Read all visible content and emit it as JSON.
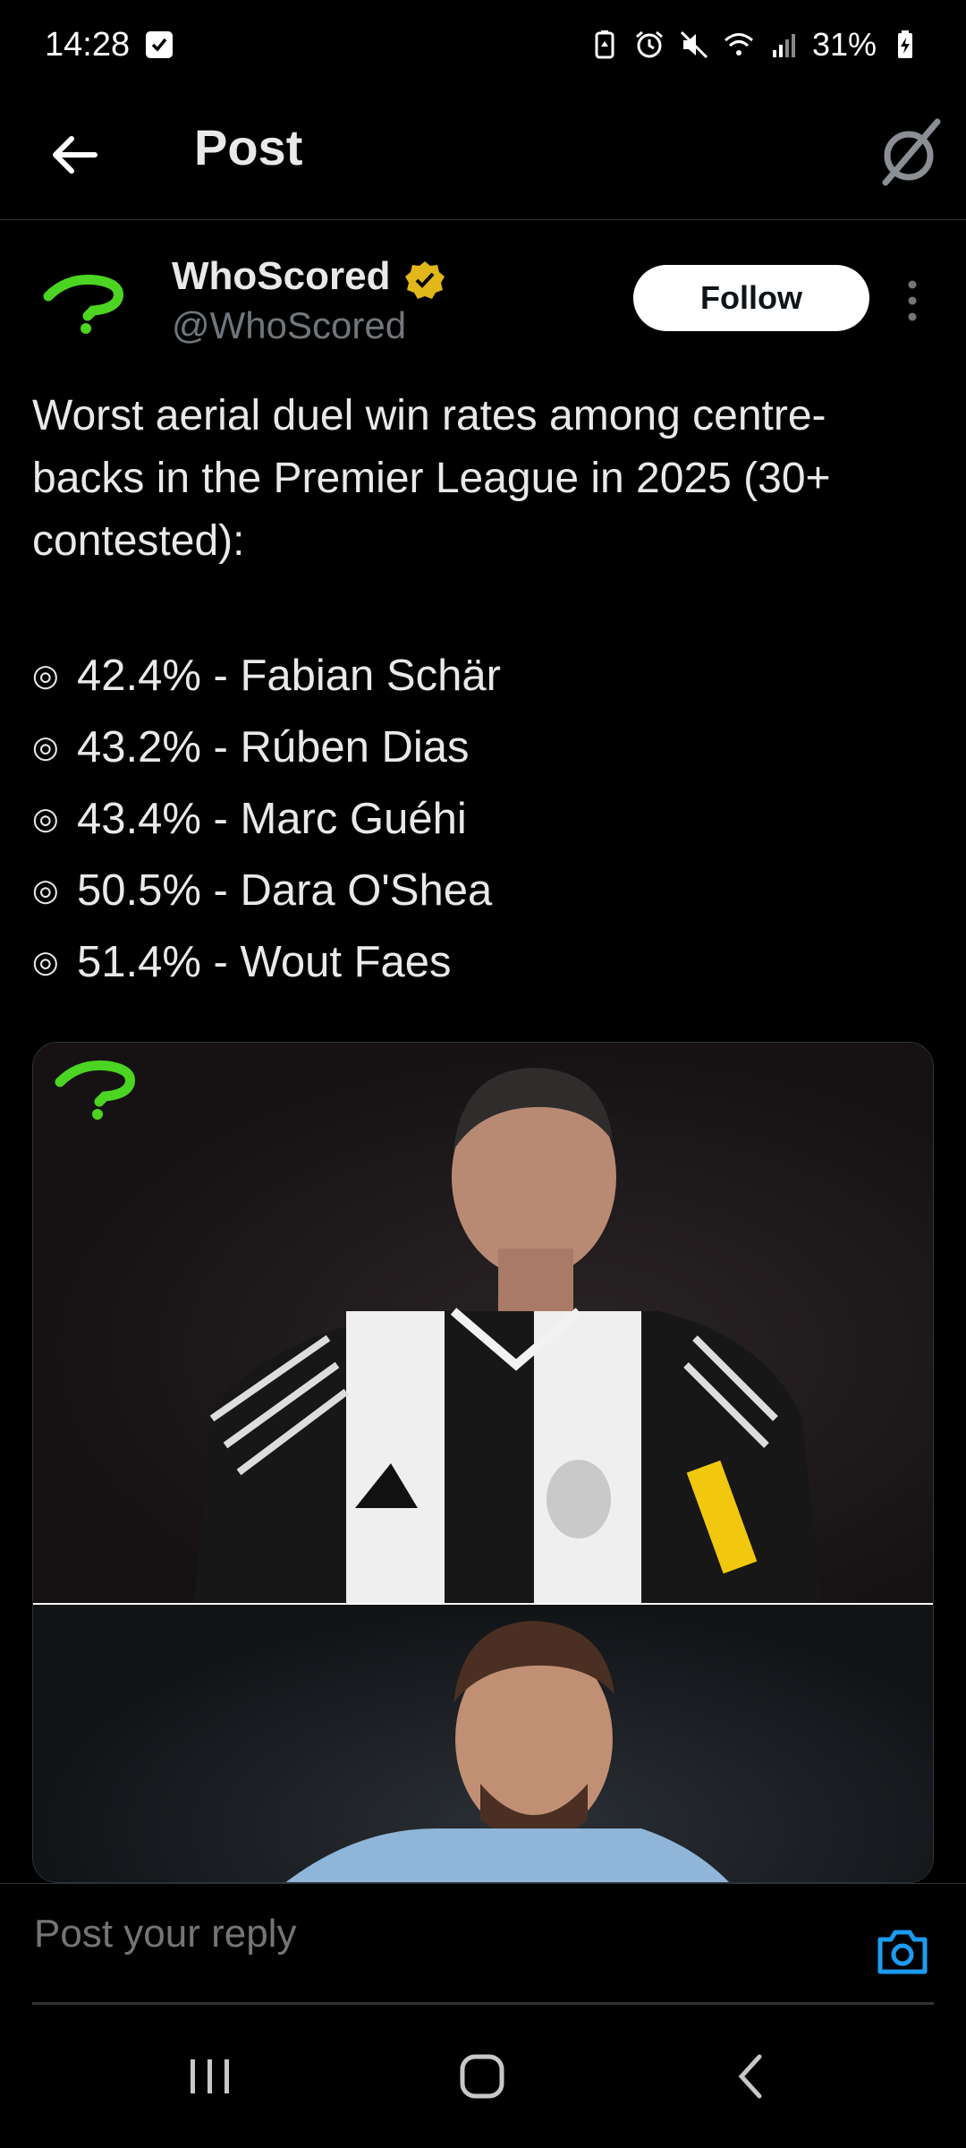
{
  "status_bar": {
    "time": "14:28",
    "battery": "31%",
    "icons": [
      "checkbox-icon",
      "battery-saver-icon",
      "alarm-icon",
      "mute-icon",
      "wifi-icon",
      "signal-icon",
      "battery-charging-icon"
    ]
  },
  "header": {
    "title": "Post",
    "back_icon": "arrow-left-icon",
    "right_icon": "grok-icon"
  },
  "author": {
    "display_name": "WhoScored",
    "handle": "@WhoScored",
    "verified_color": "#e2b719",
    "follow_label": "Follow",
    "logo_color": "#4cd422"
  },
  "post": {
    "text": "Worst aerial duel win rates among centre-backs in the Premier League in 2025 (30+ contested):",
    "bullet_symbol": "◎",
    "items": [
      "42.4% - Fabian Schär",
      "43.2% - Rúben Dias",
      "43.4% - Marc Guéhi",
      "50.5% - Dara O'Shea",
      "51.4% - Wout Faes"
    ]
  },
  "reply": {
    "placeholder": "Post your reply",
    "camera_color": "#1d9bf0"
  },
  "nav": {
    "icons": [
      "recents-icon",
      "home-icon",
      "back-icon"
    ]
  }
}
